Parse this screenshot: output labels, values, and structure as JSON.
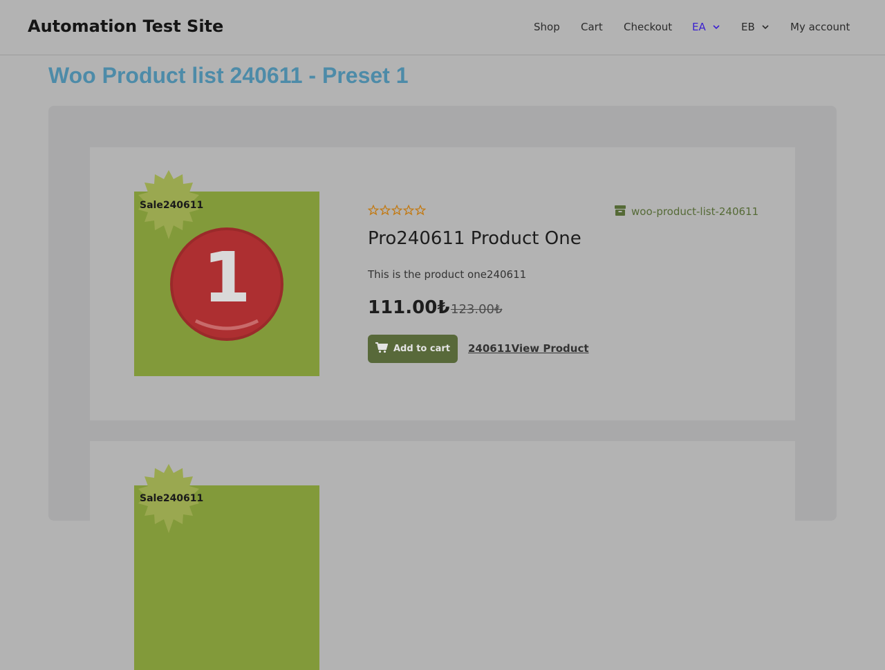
{
  "header": {
    "site_title": "Automation Test Site",
    "nav": [
      {
        "label": "Shop"
      },
      {
        "label": "Cart"
      },
      {
        "label": "Checkout"
      },
      {
        "label": "EA",
        "active": true,
        "has_dropdown": true
      },
      {
        "label": "EB",
        "has_dropdown": true
      },
      {
        "label": "My account"
      }
    ]
  },
  "page": {
    "title": "Woo Product list 240611 - Preset 1"
  },
  "products": [
    {
      "badge": "Sale240611",
      "image_number": "1",
      "rating_stars": 0,
      "rating_max": 5,
      "category": "woo-product-list-240611",
      "title": "Pro240611 Product One",
      "description": "This is the product one240611",
      "price_new": "111.00₺",
      "price_old": "123.00₺",
      "add_to_cart_label": "Add to cart",
      "view_label": "240611View Product"
    },
    {
      "badge": "Sale240611"
    }
  ],
  "colors": {
    "page_bg": "#b3b3b3",
    "wrap_bg": "#a9a9aa",
    "title_color": "#4d8ba8",
    "accent_active_nav": "#3a1fd0",
    "thumb_bg": "#829a3a",
    "badge_star": "#9aa850",
    "button_bg": "#58693a",
    "star_color": "#c27a14",
    "category_color": "#556a36"
  },
  "icons": {
    "chevron": "chevron-down-icon",
    "star": "star-outline-icon",
    "category": "box-icon",
    "cart": "cart-icon"
  }
}
